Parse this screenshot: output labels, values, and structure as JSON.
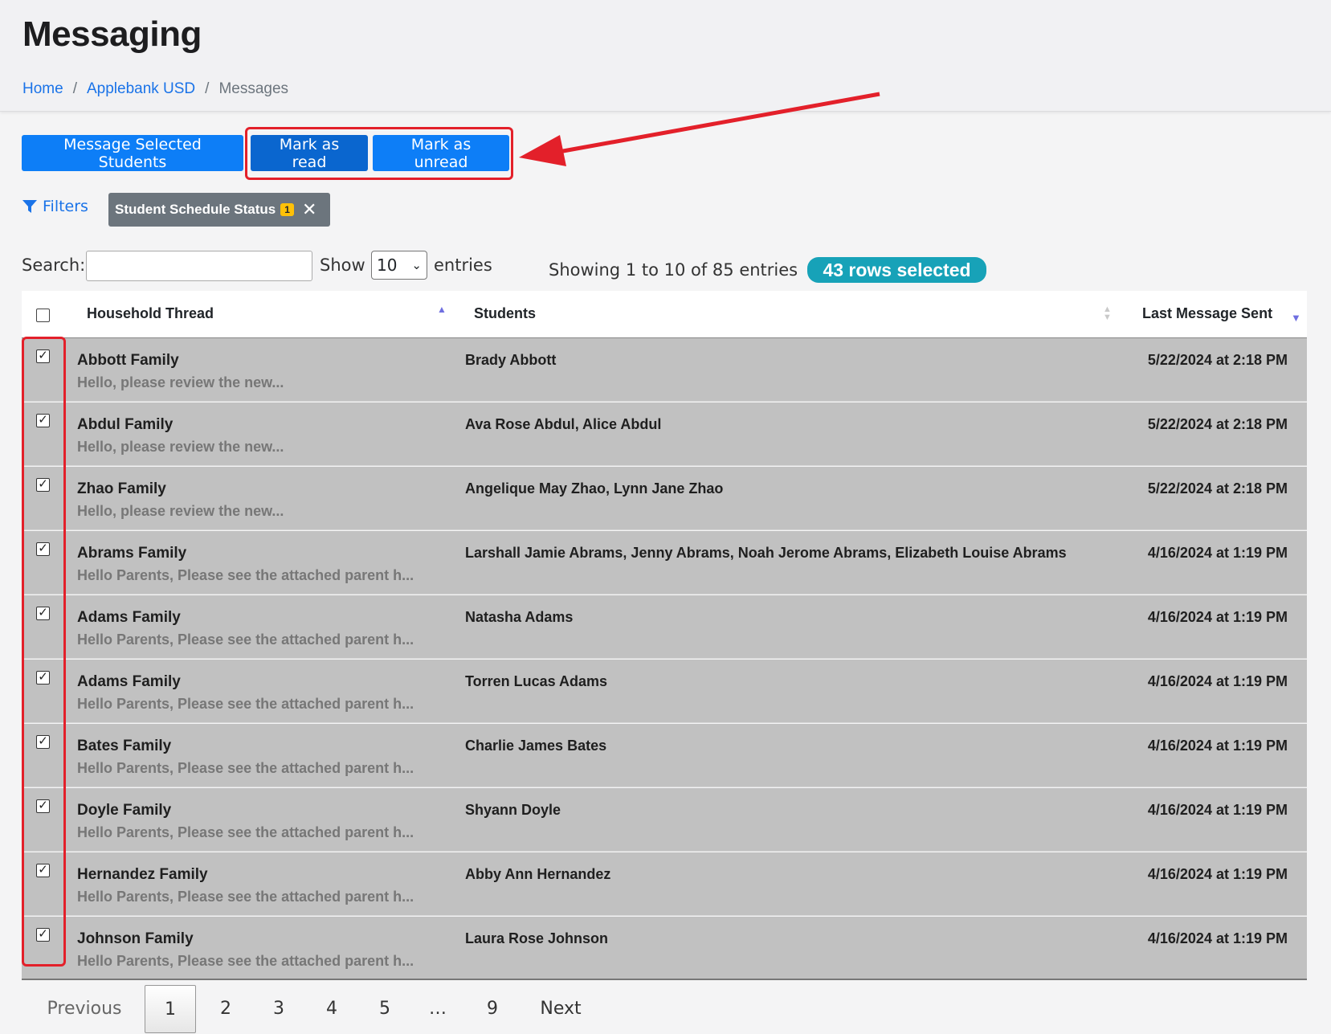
{
  "header": {
    "title": "Messaging",
    "breadcrumb": [
      "Home",
      "Applebank USD",
      "Messages"
    ],
    "separator": "/"
  },
  "actions": {
    "message_selected": "Message Selected Students",
    "mark_read": "Mark as read",
    "mark_unread": "Mark as unread"
  },
  "filters": {
    "label": "Filters",
    "chip_label": "Student Schedule Status",
    "chip_count": "1",
    "chip_close": "✕"
  },
  "controls": {
    "search_label": "Search:",
    "search_value": "",
    "show_label": "Show",
    "show_value": "10",
    "entries_label": "entries",
    "info": "Showing 1 to 10 of 85 entries",
    "selected_badge": "43 rows selected"
  },
  "table": {
    "headers": [
      "Household Thread",
      "Students",
      "Last Message Sent"
    ],
    "rows": [
      {
        "family": "Abbott Family",
        "preview": "Hello, please review the new...",
        "students": "Brady Abbott",
        "date": "5/22/2024 at 2:18 PM",
        "checked": true
      },
      {
        "family": "Abdul Family",
        "preview": "Hello, please review the new...",
        "students": "Ava Rose Abdul, Alice Abdul",
        "date": "5/22/2024 at 2:18 PM",
        "checked": true
      },
      {
        "family": "Zhao Family",
        "preview": "Hello, please review the new...",
        "students": "Angelique May Zhao, Lynn Jane Zhao",
        "date": "5/22/2024 at 2:18 PM",
        "checked": true
      },
      {
        "family": "Abrams Family",
        "preview": "Hello Parents, Please see the attached parent h...",
        "students": "Larshall Jamie Abrams, Jenny Abrams, Noah Jerome Abrams, Elizabeth Louise Abrams",
        "date": "4/16/2024 at 1:19 PM",
        "checked": true
      },
      {
        "family": "Adams Family",
        "preview": "Hello Parents, Please see the attached parent h...",
        "students": "Natasha Adams",
        "date": "4/16/2024 at 1:19 PM",
        "checked": true
      },
      {
        "family": "Adams Family",
        "preview": "Hello Parents, Please see the attached parent h...",
        "students": "Torren Lucas Adams",
        "date": "4/16/2024 at 1:19 PM",
        "checked": true
      },
      {
        "family": "Bates Family",
        "preview": "Hello Parents, Please see the attached parent h...",
        "students": "Charlie James Bates",
        "date": "4/16/2024 at 1:19 PM",
        "checked": true
      },
      {
        "family": "Doyle Family",
        "preview": "Hello Parents, Please see the attached parent h...",
        "students": "Shyann Doyle",
        "date": "4/16/2024 at 1:19 PM",
        "checked": true
      },
      {
        "family": "Hernandez Family",
        "preview": "Hello Parents, Please see the attached parent h...",
        "students": "Abby Ann Hernandez",
        "date": "4/16/2024 at 1:19 PM",
        "checked": true
      },
      {
        "family": "Johnson Family",
        "preview": "Hello Parents, Please see the attached parent h...",
        "students": "Laura Rose Johnson",
        "date": "4/16/2024 at 1:19 PM",
        "checked": true
      }
    ]
  },
  "pagination": {
    "previous": "Previous",
    "pages": [
      "1",
      "2",
      "3",
      "4",
      "5",
      "…",
      "9"
    ],
    "current": "1",
    "next": "Next"
  },
  "colors": {
    "primary": "#0d7ef7",
    "primary_active": "#0a66cf",
    "annotation": "#e3202a",
    "badge": "#17a2b8",
    "selected_row": "#c1c1c1"
  }
}
